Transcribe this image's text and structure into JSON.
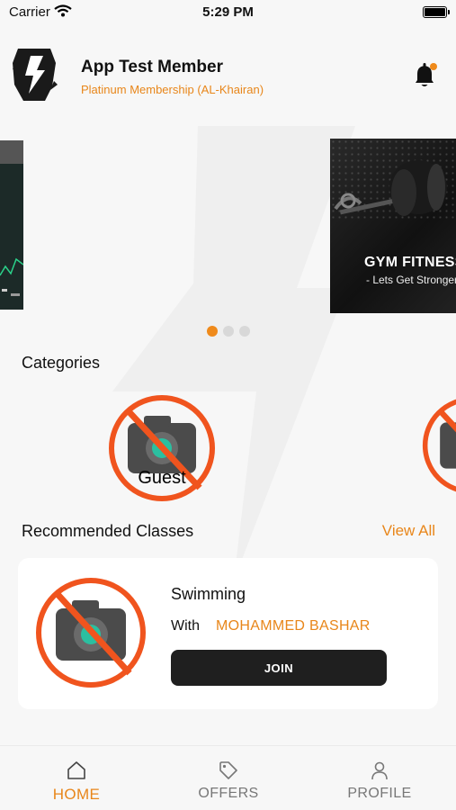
{
  "status_bar": {
    "carrier": "Carrier",
    "time": "5:29 PM"
  },
  "header": {
    "member_name": "App Test Member",
    "membership": "Platinum Membership (AL-Khairan)"
  },
  "banner": {
    "title": "GYM FITNESS",
    "subtitle": "- Lets Get Stronger"
  },
  "carousel": {
    "dot_count": 3,
    "active_index": 0
  },
  "categories": {
    "title": "Categories",
    "items": [
      {
        "label": "Guest"
      }
    ]
  },
  "recommended": {
    "title": "Recommended Classes",
    "view_all": "View All",
    "class": {
      "name": "Swimming",
      "with_label": "With",
      "trainer": "MOHAMMED BASHAR",
      "join_label": "JOIN"
    }
  },
  "tab_bar": {
    "home": "HOME",
    "offers": "OFFERS",
    "profile": "PROFILE"
  },
  "colors": {
    "accent": "#ef8a1b",
    "placeholder_red": "#f0541e",
    "dark_button": "#1f1f1f"
  }
}
